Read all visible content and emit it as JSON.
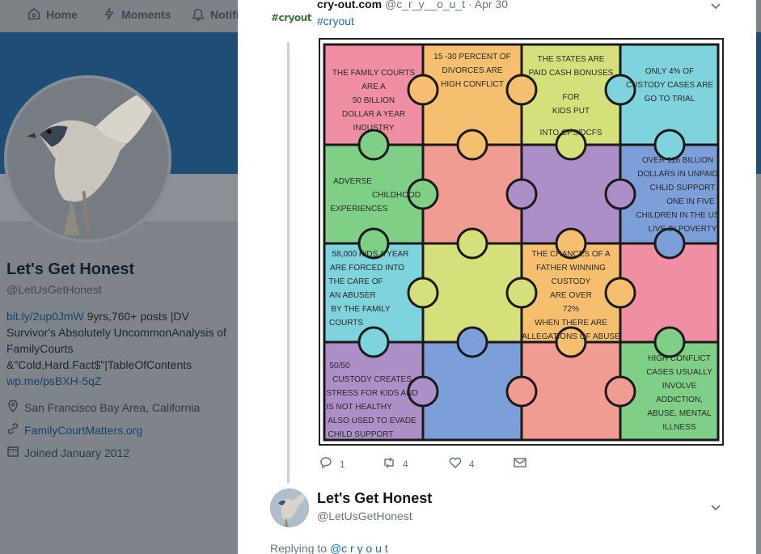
{
  "nav": {
    "home": "Home",
    "moments": "Moments",
    "notifications": "Notifi"
  },
  "profile": {
    "name": "Let's Get Honest",
    "handle": "@LetUsGetHonest",
    "bio_link": "bit.ly/2up0JmW",
    "bio_text_1": " 9yrs,760+ posts |DV Survivor's Absolutely UncommonAnalysis of FamilyCourts &\"Cold,Hard.Fact$\"|TableOfContents",
    "bio_link_2": "wp.me/psBXH-5qZ",
    "location": "San Francisco Bay Area, California",
    "website": "FamilyCourtMatters.org",
    "joined": "Joined January 2012"
  },
  "tweet": {
    "logo_text": "#cryout",
    "author_name": "cry-out.com",
    "author_handle": "@c_r_y__o_u_t",
    "date": "· Apr 30",
    "text": "#cryout",
    "reply_count": "1",
    "retweet_count": "4",
    "like_count": "4",
    "puzzle": {
      "p1": [
        "THE FAMILY COURTS",
        "ARE A",
        "50 BILLION",
        "DOLLAR  A YEAR",
        "INDUSTRY"
      ],
      "p2": [
        "15 -30 PERCENT OF",
        "DIVORCES ARE",
        "HIGH CONFLICT"
      ],
      "p3": [
        "THE STATES ARE",
        "PAID CASH BONUSES",
        "FOR",
        "KIDS PUT",
        "INTO CPS/DCFS"
      ],
      "p4": [
        "ONLY 4% OF",
        "CUSTODY CASES ARE",
        "GO TO TRIAL"
      ],
      "p5": [
        "ADVERSE",
        "CHILDHOOD",
        "EXPERIENCES"
      ],
      "p8": [
        "OVER 116 BILLION",
        "DOLLARS IN UNPAID",
        "CHLID SUPPORT",
        "ONE IN FIVE",
        "CHILDREN IN THE US",
        "LIVE IN POVERTY"
      ],
      "p9": [
        "58,000 KIDS A YEAR",
        "ARE FORCED INTO",
        "THE CARE OF",
        "AN ABUSER",
        "BY THE FAMILY",
        "COURTS"
      ],
      "p11": [
        "THE CHANCES OF A",
        "FATHER WINNING",
        "CUSTODY",
        "ARE OVER",
        "72%",
        "WHEN THERE ARE",
        "ALLEGATIONS OF ABUSE"
      ],
      "p13": [
        "50/50",
        "CUSTODY     CREATES",
        "STRESS FOR KIDS AND",
        "IS NOT HEALTHY",
        "ALSO USED TO EVADE",
        "CHILD SUPPORT"
      ],
      "p16": [
        "HIGH CONFLICT",
        "CASES USUALLY",
        "INVOLVE",
        "ADDICTION,",
        "ABUSE, MENTAL",
        "ILLNESS"
      ]
    }
  },
  "reply": {
    "name": "Let's Get Honest",
    "handle": "@LetUsGetHonest",
    "replying_prefix": "Replying to ",
    "replying_handle": "@c r y  o u t"
  },
  "colors": {
    "pink": "#f08fa3",
    "orange": "#f5bf6f",
    "lime": "#d6e07a",
    "cyan": "#7fd3dc",
    "green": "#7fcf86",
    "salmon": "#f19c93",
    "purple": "#ad8fc8",
    "blue": "#7d9fd9",
    "link": "#1b6fae"
  }
}
